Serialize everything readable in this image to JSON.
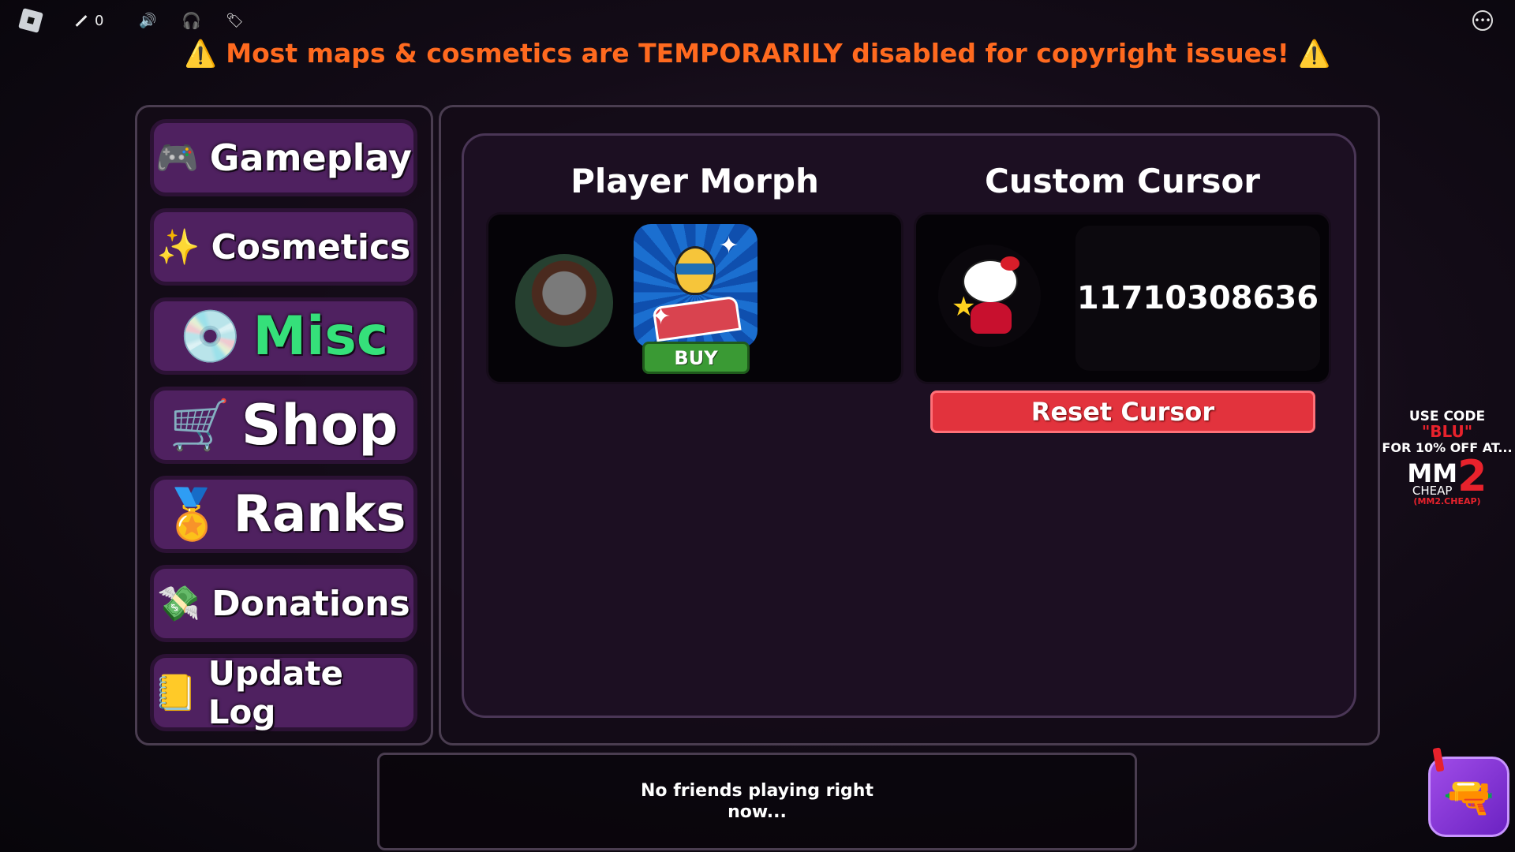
{
  "topbar": {
    "sword_count": "0",
    "icons": [
      "roblox-logo-icon",
      "sword-icon",
      "speaker-icon",
      "headphones-icon",
      "tag-icon",
      "more-icon"
    ]
  },
  "banner": {
    "warn_icon": "⚠️",
    "text": "Most maps & cosmetics are TEMPORARILY disabled for copyright issues!"
  },
  "sidebar": {
    "items": [
      {
        "label": "Gameplay",
        "icon": "🎮"
      },
      {
        "label": "Cosmetics",
        "icon": "✨"
      },
      {
        "label": "Misc",
        "icon": "💿",
        "active_color": "#35e07a"
      },
      {
        "label": "Shop",
        "icon": "🛒"
      },
      {
        "label": "Ranks",
        "icon": "🏅"
      },
      {
        "label": "Donations",
        "icon": "💸"
      },
      {
        "label": "Update Log",
        "icon": "📒"
      }
    ]
  },
  "main": {
    "morph": {
      "title": "Player Morph",
      "buy_label": "BUY"
    },
    "cursor": {
      "title": "Custom Cursor",
      "cursor_id": "11710308636",
      "reset_label": "Reset Cursor"
    }
  },
  "friends": {
    "line1": "No friends playing right",
    "line2": "now..."
  },
  "ad": {
    "line1": "USE CODE",
    "code": "\"BLU\"",
    "line2": "FOR 10% OFF AT...",
    "brand": "MM",
    "brand_num": "2",
    "brand_sub": "CHEAP",
    "url": "(MM2.CHEAP)"
  },
  "colors": {
    "accent_purple": "#4f2160",
    "misc_green": "#35e07a",
    "reset_red": "#e2333d",
    "buy_green": "#3a9a34",
    "banner_orange": "#ff6a1f"
  }
}
